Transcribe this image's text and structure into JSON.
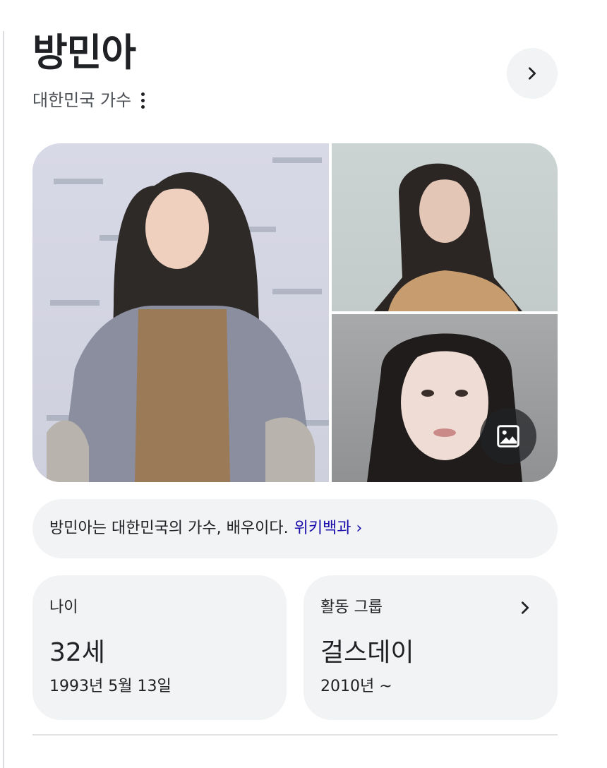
{
  "entity": {
    "name": "방민아",
    "description": "대한민국 가수"
  },
  "icons": {
    "more": "more-vertical-icon",
    "next": "chevron-right-icon",
    "images": "image-icon"
  },
  "summary": {
    "text": "방민아는 대한민국의 가수, 배우이다.",
    "link_label": "위키백과 ›"
  },
  "facts": {
    "age": {
      "label": "나이",
      "value": "32세",
      "detail": "1993년 5월 13일"
    },
    "group": {
      "label": "활동 그룹",
      "value": "걸스데이",
      "detail": "2010년 ~"
    }
  },
  "colors": {
    "link": "#1a0dab",
    "card_background": "#f1f3f4",
    "text": "#202124"
  }
}
